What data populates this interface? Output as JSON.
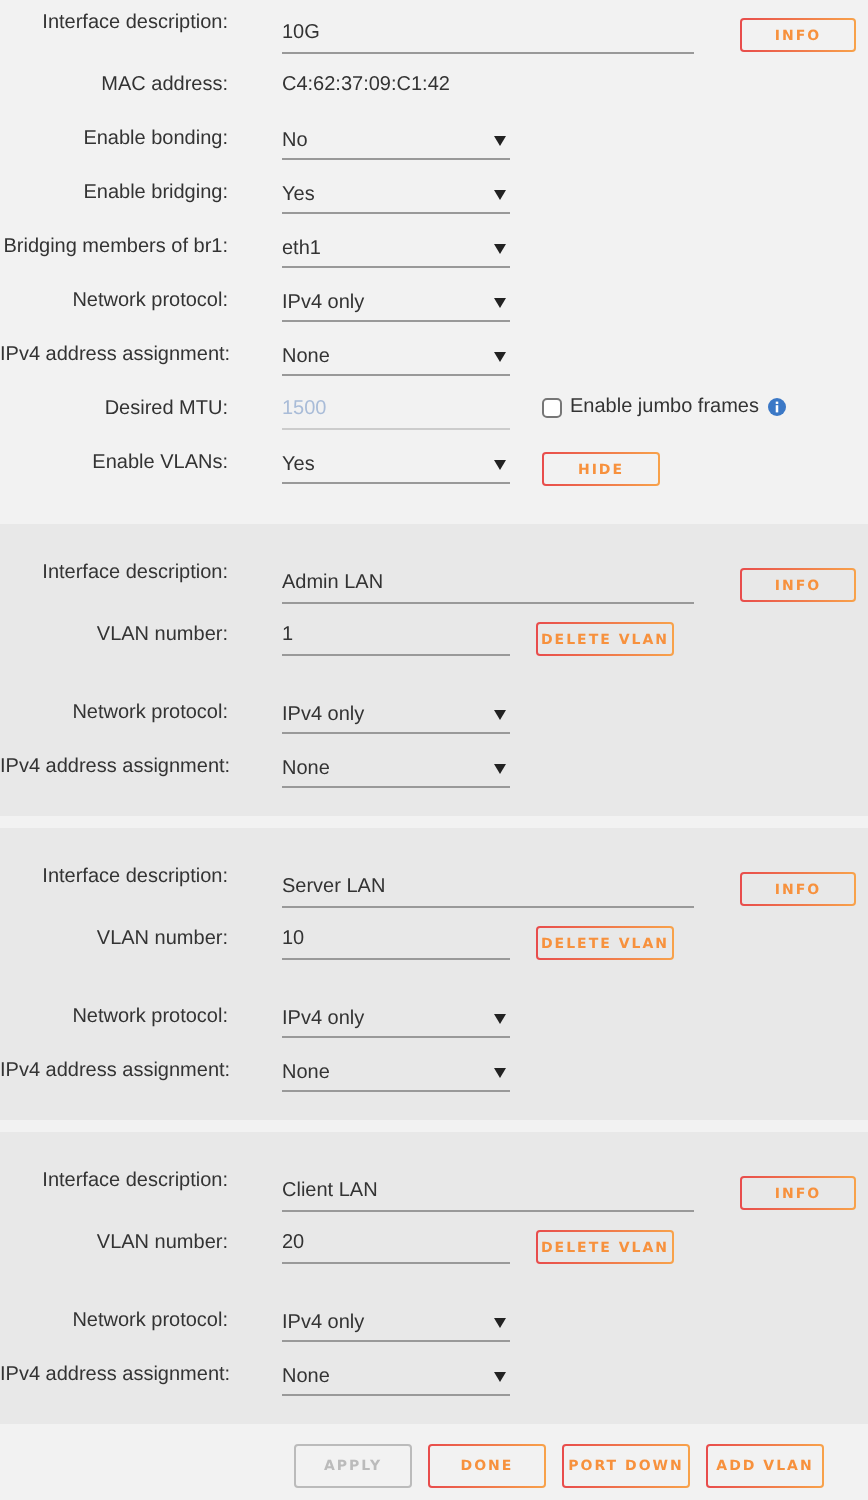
{
  "interface": [
    {
      "kind": "text",
      "label": "Interface description:",
      "value": "10G",
      "button": "INFO"
    },
    {
      "kind": "static",
      "label": "MAC address:",
      "value": "C4:62:37:09:C1:42"
    },
    {
      "kind": "select",
      "label": "Enable bonding:",
      "value": "No"
    },
    {
      "kind": "select",
      "label": "Enable bridging:",
      "value": "Yes"
    },
    {
      "kind": "select",
      "label": "Bridging members of br1:",
      "value": "eth1"
    },
    {
      "kind": "select",
      "label": "Network protocol:",
      "value": "IPv4 only"
    },
    {
      "kind": "select",
      "label": "IPv4 address assignment:",
      "value": "None"
    },
    {
      "kind": "mtu",
      "label": "Desired MTU:",
      "placeholder": "1500",
      "checkbox": {
        "label": "Enable jumbo frames",
        "checked": false
      }
    },
    {
      "kind": "select",
      "label": "Enable VLANs:",
      "value": "Yes",
      "button": "HIDE"
    }
  ],
  "vlans": [
    {
      "description_label": "Interface description:",
      "description": "Admin LAN",
      "info_button": "INFO",
      "number_label": "VLAN number:",
      "number": "1",
      "delete_button": "DELETE VLAN",
      "protocol_label": "Network protocol:",
      "protocol": "IPv4 only",
      "assignment_label": "IPv4 address assignment:",
      "assignment": "None"
    },
    {
      "description_label": "Interface description:",
      "description": "Server LAN",
      "info_button": "INFO",
      "number_label": "VLAN number:",
      "number": "10",
      "delete_button": "DELETE VLAN",
      "protocol_label": "Network protocol:",
      "protocol": "IPv4 only",
      "assignment_label": "IPv4 address assignment:",
      "assignment": "None"
    },
    {
      "description_label": "Interface description:",
      "description": "Client LAN",
      "info_button": "INFO",
      "number_label": "VLAN number:",
      "number": "20",
      "delete_button": "DELETE VLAN",
      "protocol_label": "Network protocol:",
      "protocol": "IPv4 only",
      "assignment_label": "IPv4 address assignment:",
      "assignment": "None"
    }
  ],
  "footer_buttons": [
    {
      "label": "APPLY",
      "disabled": true
    },
    {
      "label": "DONE",
      "disabled": false
    },
    {
      "label": "PORT DOWN",
      "disabled": false
    },
    {
      "label": "ADD VLAN",
      "disabled": false
    }
  ]
}
